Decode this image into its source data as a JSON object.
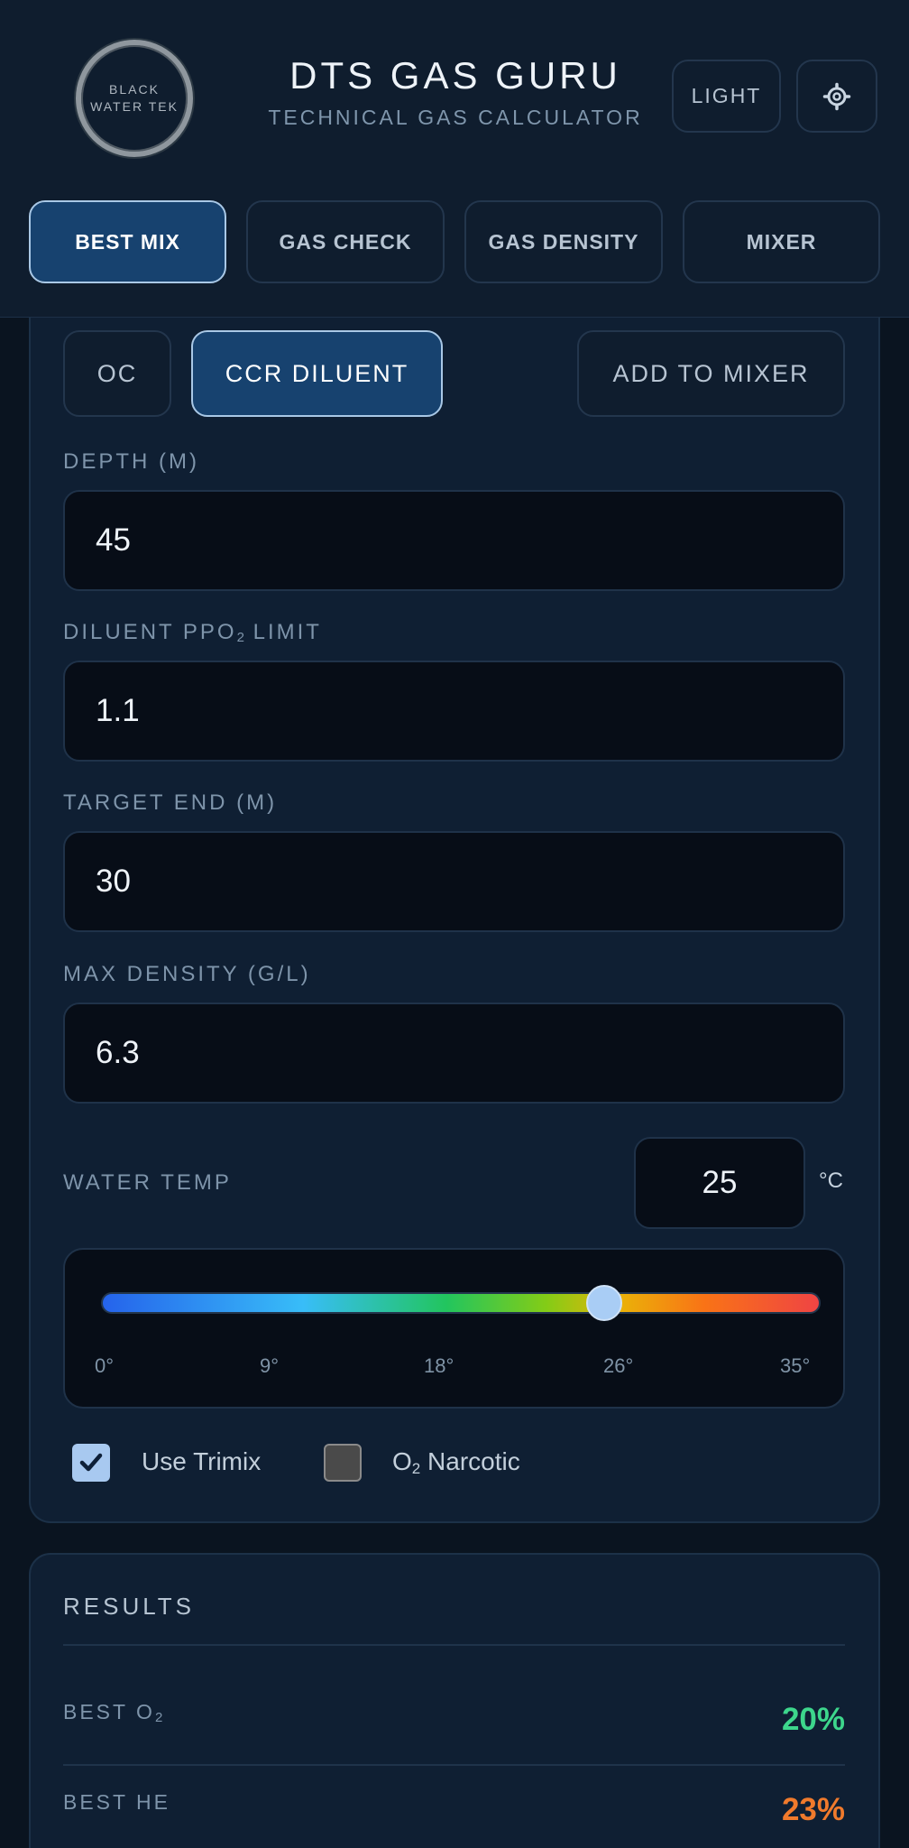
{
  "header": {
    "logo_line1": "BLACK",
    "logo_line2": "WATER TEK",
    "title": "DTS GAS GURU",
    "subtitle": "TECHNICAL GAS CALCULATOR",
    "theme_label": "LIGHT",
    "settings_icon": "gear-icon"
  },
  "tabs": [
    {
      "label": "BEST MIX",
      "active": true
    },
    {
      "label": "GAS CHECK",
      "active": false
    },
    {
      "label": "GAS DENSITY",
      "active": false
    },
    {
      "label": "MIXER",
      "active": false
    }
  ],
  "mode": {
    "oc_label": "OC",
    "ccr_label": "CCR DILUENT",
    "add_label": "ADD TO MIXER",
    "selected": "CCR DILUENT"
  },
  "fields": {
    "depth": {
      "label": "DEPTH (M)",
      "value": "45"
    },
    "ppo2": {
      "label_pre": "DILUENT PPO",
      "label_sub": "2",
      "label_post": " LIMIT",
      "value": "1.1"
    },
    "end": {
      "label": "TARGET END (M)",
      "value": "30"
    },
    "density": {
      "label": "MAX DENSITY (G/L)",
      "value": "6.3"
    }
  },
  "water_temp": {
    "label": "WATER TEMP",
    "value": "25",
    "unit": "°C",
    "slider_min": 0,
    "slider_max": 35,
    "slider_value": 25,
    "ticks": [
      "0°",
      "9°",
      "18°",
      "26°",
      "35°"
    ]
  },
  "options": {
    "trimix": {
      "label": "Use Trimix",
      "checked": true
    },
    "o2_narcotic": {
      "label_pre": "O",
      "label_sub": "2",
      "label_post": " Narcotic",
      "checked": false
    }
  },
  "results": {
    "title": "RESULTS",
    "best_o2": {
      "label_pre": "BEST O",
      "label_sub": "2",
      "value": "20%",
      "color": "#3dd68c"
    },
    "best_he": {
      "label": "BEST HE",
      "value": "23%",
      "color": "#f07a2c"
    }
  }
}
